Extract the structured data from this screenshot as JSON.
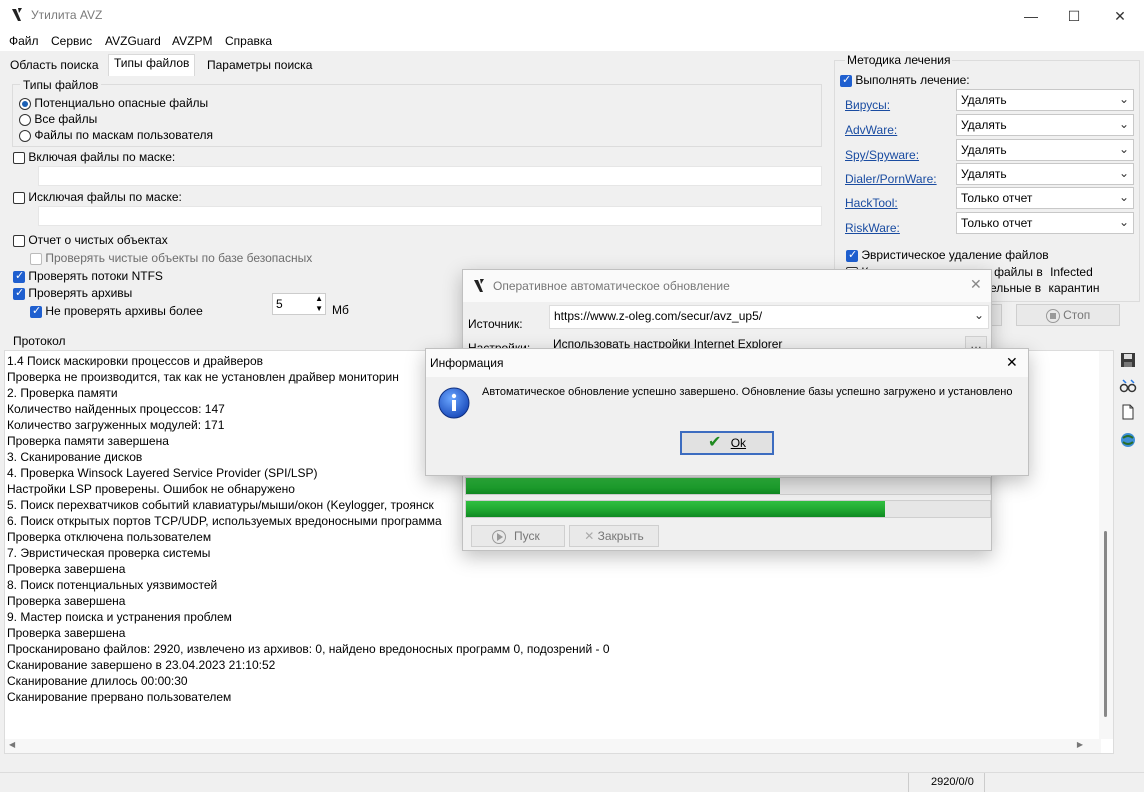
{
  "window": {
    "title": "Утилита AVZ"
  },
  "menu": [
    "Файл",
    "Сервис",
    "AVZGuard",
    "AVZPM",
    "Справка"
  ],
  "tabs": [
    "Область поиска",
    "Типы файлов",
    "Параметры поиска"
  ],
  "file_types": {
    "group_label": "Типы файлов",
    "options": [
      "Потенциально опасные файлы",
      "Все файлы",
      "Файлы по маскам пользователя"
    ],
    "selected_index": 0
  },
  "include_mask_label": "Включая файлы по маске:",
  "exclude_mask_label": "Исключая файлы по маске:",
  "report_clean_label": "Отчет о чистых объектах",
  "check_clean_safe_label": "Проверять чистые объекты по базе безопасных",
  "ntfs_label": "Проверять потоки NTFS",
  "archives_label": "Проверять архивы",
  "skip_archives_label": "Не проверять архивы более",
  "archive_size_value": "5",
  "archive_size_unit": "Мб",
  "treatment": {
    "group_label": "Методика лечения",
    "perform_label": "Выполнять лечение:",
    "rows": [
      {
        "label": "Вирусы:",
        "value": "Удалять"
      },
      {
        "label": "AdvWare:",
        "value": "Удалять"
      },
      {
        "label": "Spy/Spyware:",
        "value": "Удалять"
      },
      {
        "label": "Dialer/PornWare:",
        "value": "Удалять"
      },
      {
        "label": "HackTool:",
        "value": "Только отчет"
      },
      {
        "label": "RiskWare:",
        "value": "Только отчет"
      }
    ],
    "heuristic_delete_label": "Эвристическое удаление файлов",
    "copy_deleted_label": "Копировать удаленные файлы в",
    "infected_label": "Infected",
    "quarantine_tail": "ельные в",
    "quarantine_word": "карантин"
  },
  "stop_button": "Стоп",
  "protocol": {
    "label": "Протокол",
    "lines": [
      "1.4 Поиск маскировки процессов и драйверов",
      " Проверка не производится, так как не установлен драйвер мониторин",
      "2. Проверка памяти",
      " Количество найденных процессов: 147",
      " Количество загруженных модулей: 171",
      "Проверка памяти завершена",
      "3. Сканирование дисков",
      "4. Проверка Winsock Layered Service Provider (SPI/LSP)",
      " Настройки LSP проверены. Ошибок не обнаружено",
      "5. Поиск перехватчиков событий клавиатуры/мыши/окон (Keylogger, троянск",
      "6. Поиск открытых портов TCP/UDP, используемых вредоносными программа",
      " Проверка отключена пользователем",
      "7. Эвристическая проверка системы",
      "Проверка завершена",
      "8. Поиск потенциальных уязвимостей",
      "Проверка завершена",
      "9. Мастер поиска и устранения проблем",
      "Проверка завершена",
      "Просканировано файлов: 2920, извлечено из архивов: 0, найдено вредоносных программ 0, подозрений - 0",
      "Сканирование завершено в 23.04.2023 21:10:52",
      "Сканирование длилось 00:00:30",
      "Сканирование прервано пользователем"
    ]
  },
  "status": {
    "counts": "2920/0/0"
  },
  "update_dialog": {
    "title": "Оперативное автоматическое обновление",
    "source_label": "Источник:",
    "source_value": "https://www.z-oleg.com/secur/avz_up5/",
    "settings_label": "Настройки:",
    "settings_value": "Использовать настройки Internet Explorer",
    "progress": [
      0.6,
      0.8
    ],
    "start_button": "Пуск",
    "close_button": "Закрыть"
  },
  "info_dialog": {
    "title": "Информация",
    "message": "Автоматическое обновление успешно завершено. Обновление базы успешно загружено и установлено",
    "ok_button": "Ok"
  }
}
